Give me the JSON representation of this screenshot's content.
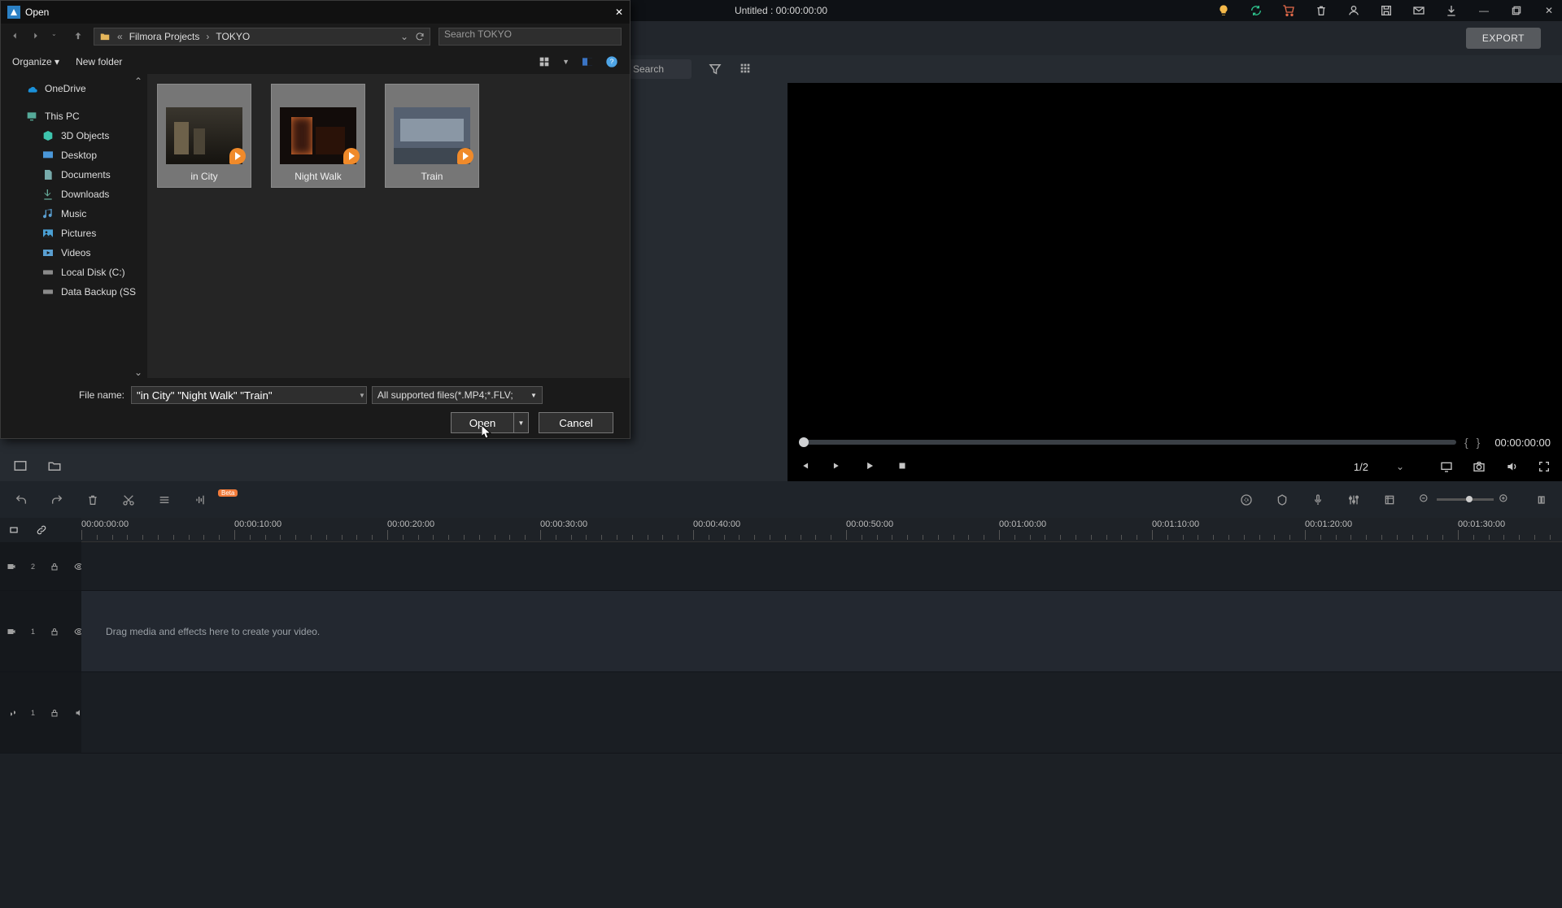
{
  "app": {
    "title": "Untitled : 00:00:00:00",
    "export_label": "EXPORT",
    "search_placeholder": "Search"
  },
  "dialog": {
    "title": "Open",
    "breadcrumb": [
      "Filmora Projects",
      "TOKYO"
    ],
    "search_placeholder": "Search TOKYO",
    "organize_label": "Organize",
    "new_folder_label": "New folder",
    "sidebar": [
      {
        "label": "OneDrive",
        "icon": "cloud"
      },
      {
        "label": "This PC",
        "icon": "pc"
      },
      {
        "label": "3D Objects",
        "icon": "cube"
      },
      {
        "label": "Desktop",
        "icon": "desktop"
      },
      {
        "label": "Documents",
        "icon": "doc"
      },
      {
        "label": "Downloads",
        "icon": "download"
      },
      {
        "label": "Music",
        "icon": "music"
      },
      {
        "label": "Pictures",
        "icon": "pic"
      },
      {
        "label": "Videos",
        "icon": "video"
      },
      {
        "label": "Local Disk (C:)",
        "icon": "disk"
      },
      {
        "label": "Data Backup (SS",
        "icon": "disk"
      }
    ],
    "files": [
      {
        "name": "in City"
      },
      {
        "name": "Night Walk"
      },
      {
        "name": "Train"
      }
    ],
    "file_name_label": "File name:",
    "file_name_value": "\"in City\" \"Night Walk\" \"Train\"",
    "file_type": "All supported files(*.MP4;*.FLV;",
    "open_label": "Open",
    "cancel_label": "Cancel"
  },
  "preview": {
    "time": "00:00:00:00",
    "zoom": "1/2"
  },
  "timeline": {
    "marks": [
      "00:00:00:00",
      "00:00:10:00",
      "00:00:20:00",
      "00:00:30:00",
      "00:00:40:00",
      "00:00:50:00",
      "00:01:00:00",
      "00:01:10:00",
      "00:01:20:00",
      "00:01:30:00"
    ],
    "tracks": [
      {
        "id": "2",
        "icon": "video",
        "hint": ""
      },
      {
        "id": "1",
        "icon": "video",
        "hint": "Drag media and effects here to create your video."
      },
      {
        "id": "1",
        "icon": "audio",
        "hint": ""
      }
    ],
    "beta_label": "Beta"
  }
}
